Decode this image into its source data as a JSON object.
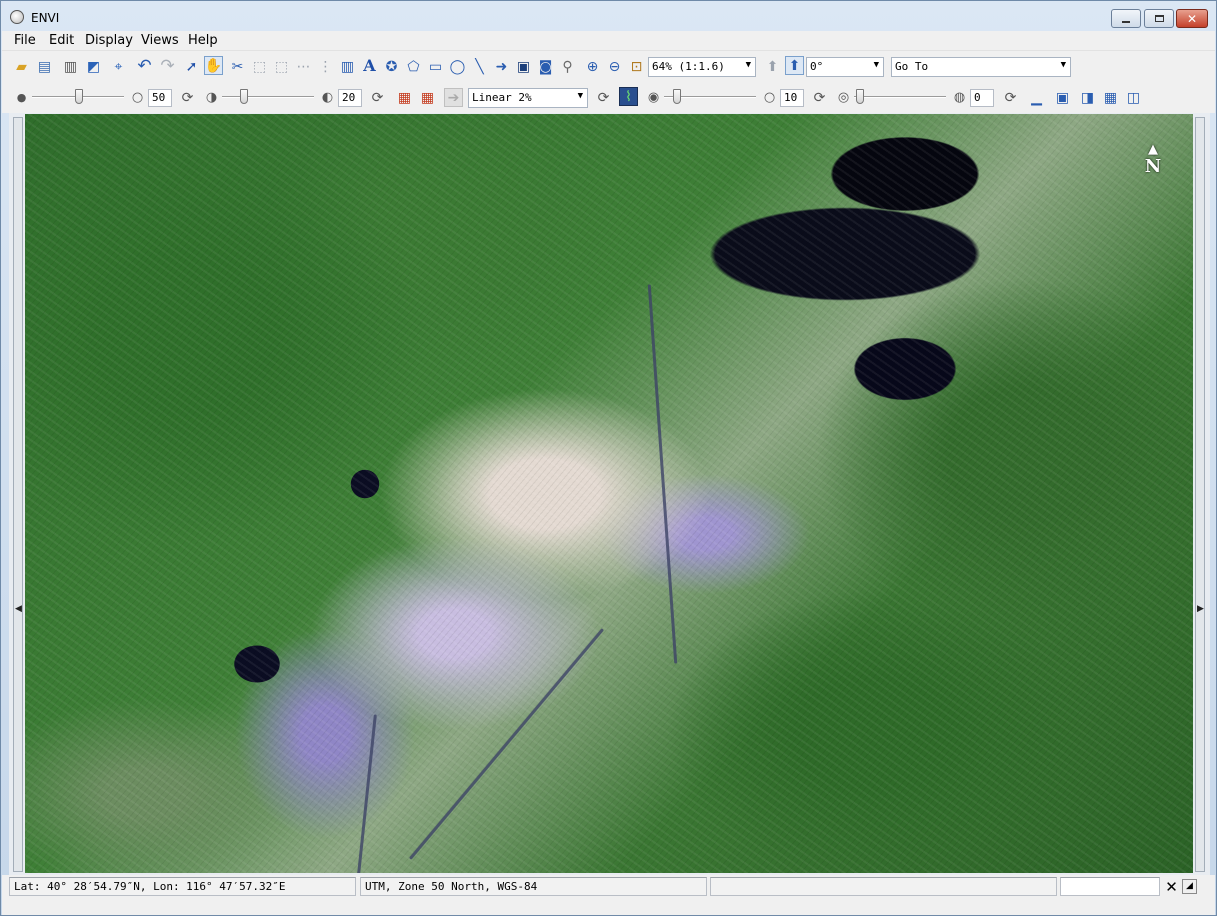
{
  "window": {
    "title": "ENVI"
  },
  "menu": [
    "File",
    "Edit",
    "Display",
    "Views",
    "Help"
  ],
  "toolbar1": {
    "icons": [
      "open-icon",
      "layer-manager-icon",
      "print-icon",
      "export-icon",
      "crosshair-icon",
      "undo-icon",
      "redo-icon",
      "select-icon",
      "pan-icon",
      "rotate-icon",
      "vector-icon",
      "annotate-text-icon",
      "polygon-icon",
      "rectangle-icon",
      "ellipse-icon",
      "line-icon",
      "arrow-icon",
      "zoom-in-icon",
      "zoom-out-icon"
    ],
    "zoom": "64% (1:1.6)",
    "rotation": "0°",
    "goto_placeholder": "Go To"
  },
  "toolbar2": {
    "brightness": "50",
    "contrast": "20",
    "stretch": "Linear 2%",
    "sharpen": "10",
    "transparency": "0"
  },
  "image": {
    "north_label": "N"
  },
  "status": {
    "coordinates": "Lat: 40° 28′54.79″N, Lon: 116° 47′57.32″E",
    "projection": "UTM, Zone 50 North, WGS-84",
    "field3": "",
    "field4": ""
  },
  "colors": {
    "vegetation": "#2f6d2b",
    "water": "#05060f",
    "urban": "#9f95d0"
  }
}
